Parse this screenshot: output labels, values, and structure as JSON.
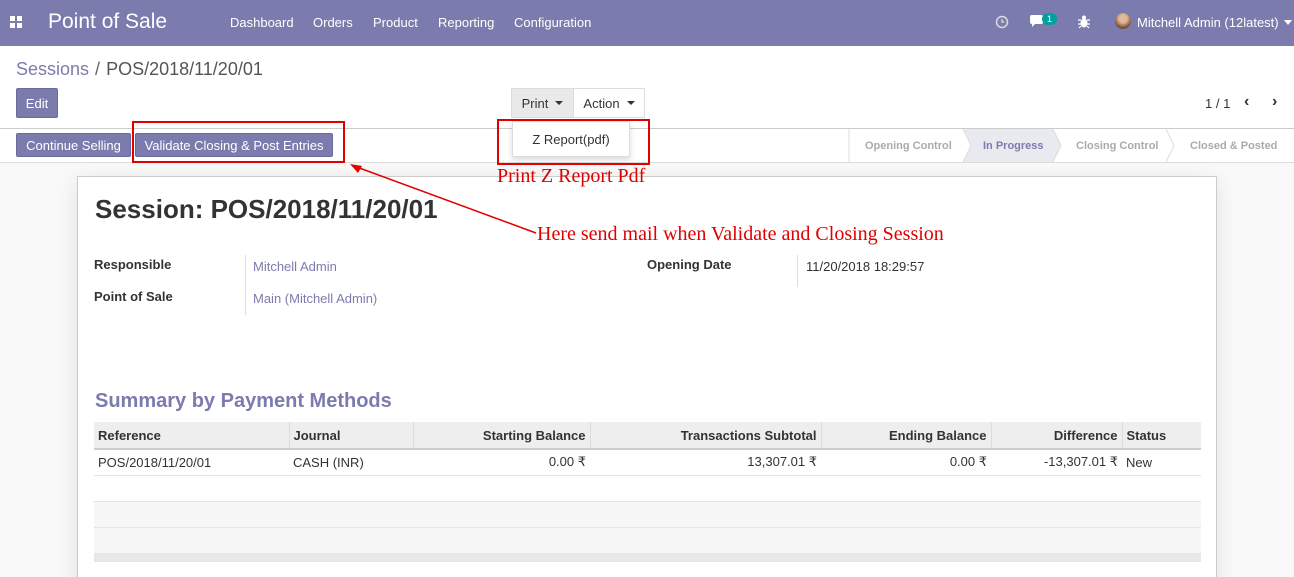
{
  "navbar": {
    "app_name": "Point of Sale",
    "menu": [
      "Dashboard",
      "Orders",
      "Product",
      "Reporting",
      "Configuration"
    ],
    "icons": [
      "apps-icon",
      "clock-icon",
      "chat-icon",
      "bug-icon"
    ],
    "chat_badge": "1",
    "user": "Mitchell Admin (12latest)",
    "bg_color": "#7c7bad"
  },
  "breadcrumb": {
    "parent": "Sessions",
    "separator": "/",
    "current": "POS/2018/11/20/01"
  },
  "toolbar": {
    "edit": "Edit",
    "print": "Print",
    "action": "Action",
    "pager": "1 / 1"
  },
  "print_menu": {
    "items": [
      "Z Report(pdf)"
    ]
  },
  "header_buttons": {
    "continue": "Continue Selling",
    "validate": "Validate Closing & Post Entries"
  },
  "stages": [
    {
      "label": "Opening Control",
      "active": false
    },
    {
      "label": "In Progress",
      "active": true
    },
    {
      "label": "Closing Control",
      "active": false
    },
    {
      "label": "Closed & Posted",
      "active": false
    }
  ],
  "annotations": {
    "print_note": "Print Z Report Pdf",
    "validate_note": "Here send mail when Validate and Closing Session",
    "color": "#e00000"
  },
  "form": {
    "title": "Session: POS/2018/11/20/01",
    "responsible_label": "Responsible",
    "responsible": "Mitchell Admin",
    "pos_label": "Point of Sale",
    "pos": "Main (Mitchell Admin)",
    "opening_date_label": "Opening Date",
    "opening_date": "11/20/2018 18:29:57"
  },
  "summary": {
    "title": "Summary by Payment Methods",
    "columns": [
      "Reference",
      "Journal",
      "Starting Balance",
      "Transactions Subtotal",
      "Ending Balance",
      "Difference",
      "Status"
    ],
    "rows": [
      {
        "reference": "POS/2018/11/20/01",
        "journal": "CASH (INR)",
        "starting": "0.00 ₹",
        "subtotal": "13,307.01 ₹",
        "ending": "0.00 ₹",
        "difference": "-13,307.01 ₹",
        "status": "New"
      }
    ]
  }
}
